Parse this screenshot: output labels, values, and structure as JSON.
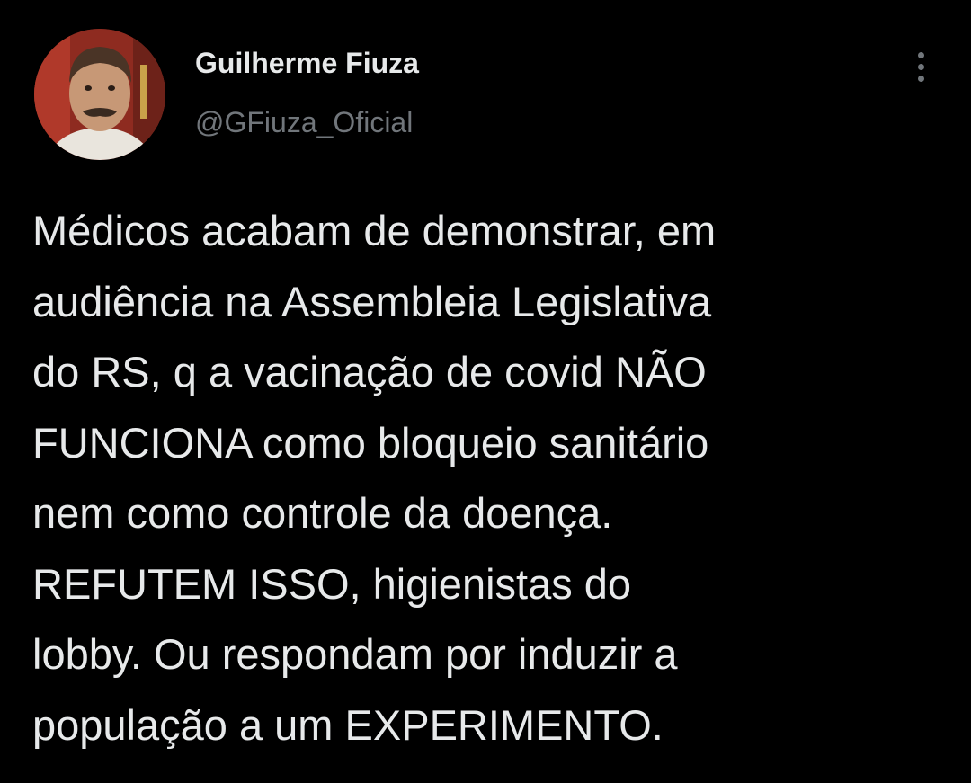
{
  "author": {
    "display_name": "Guilherme Fiuza",
    "handle": "@GFiuza_Oficial",
    "avatar_icon": "profile-photo"
  },
  "menu": {
    "icon": "more-vertical-icon"
  },
  "tweet": {
    "lines": [
      "Médicos acabam de demonstrar, em",
      "audiência na Assembleia Legislativa",
      "do RS, q a vacinação de covid NÃO",
      "FUNCIONA como bloqueio sanitário",
      "nem como controle da doença.",
      "REFUTEM ISSO, higienistas do",
      "lobby. Ou respondam por induzir a",
      "população a um EXPERIMENTO."
    ]
  },
  "theme": {
    "background": "#000000",
    "text_primary": "#e7e9ea",
    "text_secondary": "#71767b"
  }
}
